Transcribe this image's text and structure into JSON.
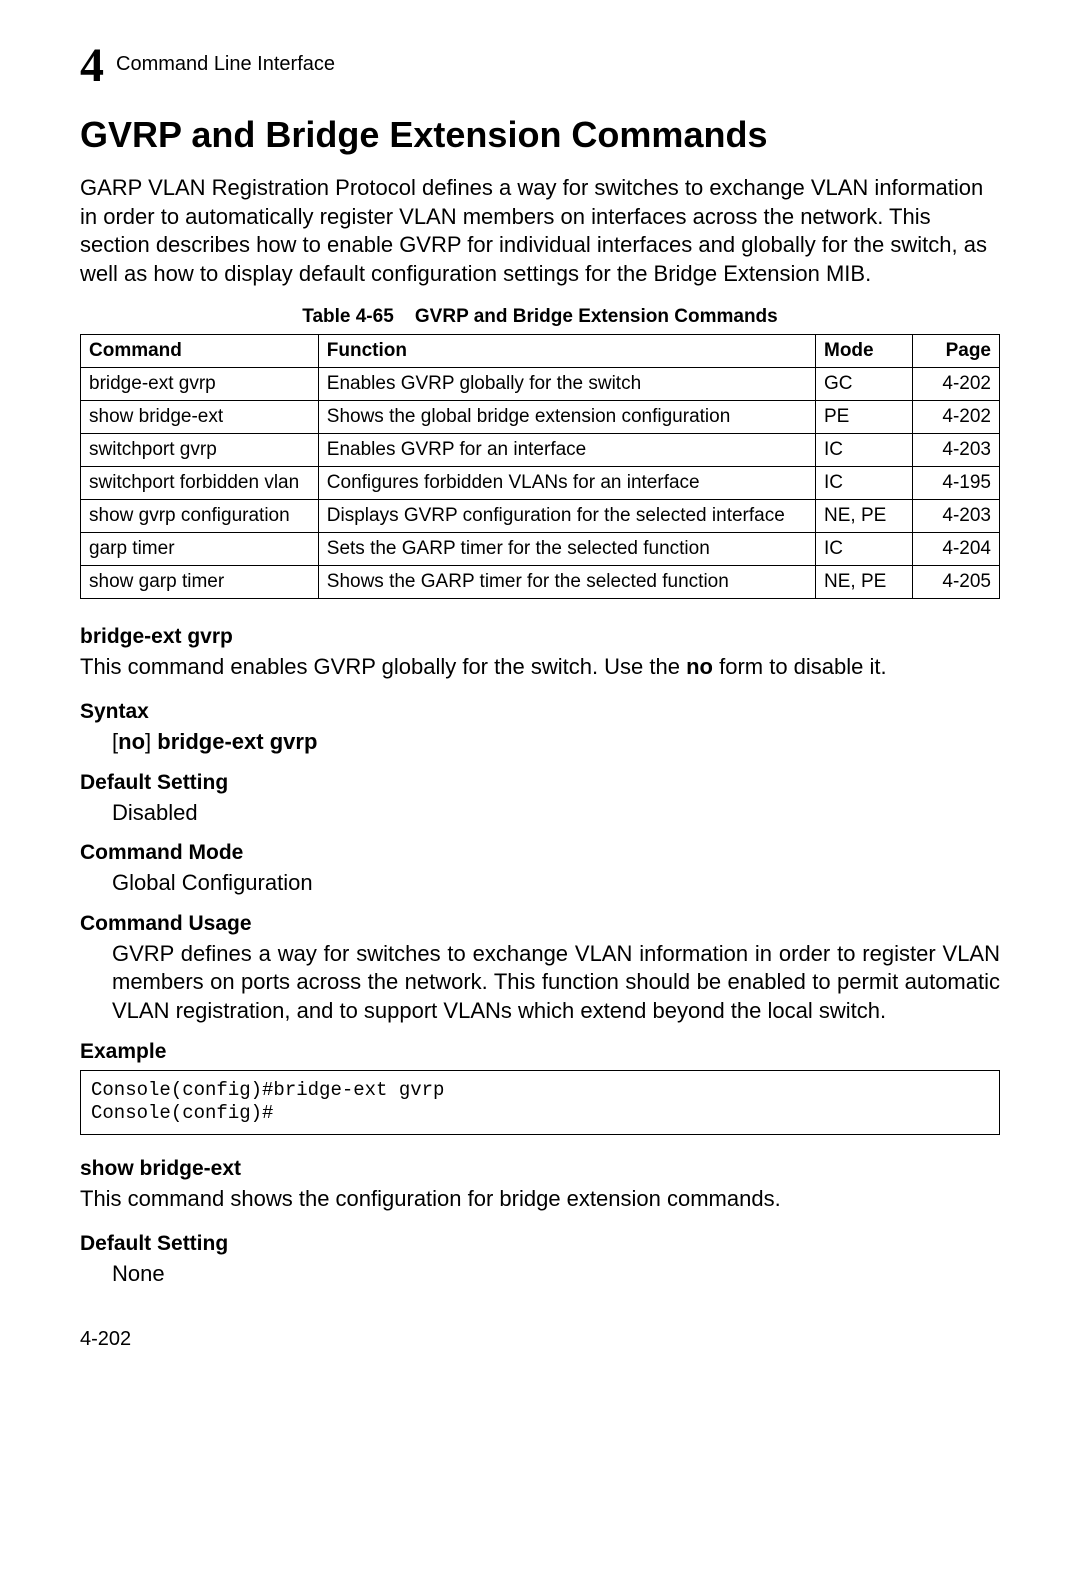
{
  "header": {
    "chapter_number": "4",
    "label": "Command Line Interface"
  },
  "title": "GVRP and Bridge Extension Commands",
  "intro": "GARP VLAN Registration Protocol defines a way for switches to exchange VLAN information in order to automatically register VLAN members on interfaces across the network. This section describes how to enable GVRP for individual interfaces and globally for the switch, as well as how to display default configuration settings for the Bridge Extension MIB.",
  "table": {
    "caption_prefix": "Table 4-65",
    "caption_text": "GVRP and Bridge Extension Commands",
    "headers": {
      "command": "Command",
      "function": "Function",
      "mode": "Mode",
      "page": "Page"
    },
    "rows": [
      {
        "command": "bridge-ext gvrp",
        "function": "Enables GVRP globally for the switch",
        "mode": "GC",
        "page": "4-202"
      },
      {
        "command": "show bridge-ext",
        "function": "Shows the global bridge extension configuration",
        "mode": "PE",
        "page": "4-202"
      },
      {
        "command": "switchport gvrp",
        "function": "Enables GVRP for an interface",
        "mode": "IC",
        "page": "4-203"
      },
      {
        "command": "switchport forbidden vlan",
        "function": "Configures forbidden VLANs for an interface",
        "mode": "IC",
        "page": "4-195"
      },
      {
        "command": "show gvrp configuration",
        "function": "Displays GVRP configuration for the selected interface",
        "mode": "NE, PE",
        "page": "4-203"
      },
      {
        "command": "garp timer",
        "function": "Sets the GARP timer for the selected function",
        "mode": "IC",
        "page": "4-204"
      },
      {
        "command": "show garp timer",
        "function": "Shows the GARP timer for the selected function",
        "mode": "NE, PE",
        "page": "4-205"
      }
    ]
  },
  "cmd1": {
    "name": "bridge-ext gvrp",
    "desc_prefix": "This command enables GVRP globally for the switch. Use the ",
    "desc_bold": "no",
    "desc_suffix": " form to disable it.",
    "syntax_heading": "Syntax",
    "syntax_bracket_open": "[",
    "syntax_no": "no",
    "syntax_bracket_close": "] ",
    "syntax_cmd": "bridge-ext gvrp",
    "default_heading": "Default Setting",
    "default_value": "Disabled",
    "mode_heading": "Command Mode",
    "mode_value": "Global Configuration",
    "usage_heading": "Command Usage",
    "usage_text": "GVRP defines a way for switches to exchange VLAN information in order to register VLAN members on ports across the network. This function should be enabled to permit automatic VLAN registration, and to support VLANs which extend beyond the local switch.",
    "example_heading": "Example",
    "example_code": "Console(config)#bridge-ext gvrp\nConsole(config)#"
  },
  "cmd2": {
    "name": "show bridge-ext",
    "desc": "This command shows the configuration for bridge extension commands.",
    "default_heading": "Default Setting",
    "default_value": "None"
  },
  "footer": {
    "page_number": "4-202"
  }
}
